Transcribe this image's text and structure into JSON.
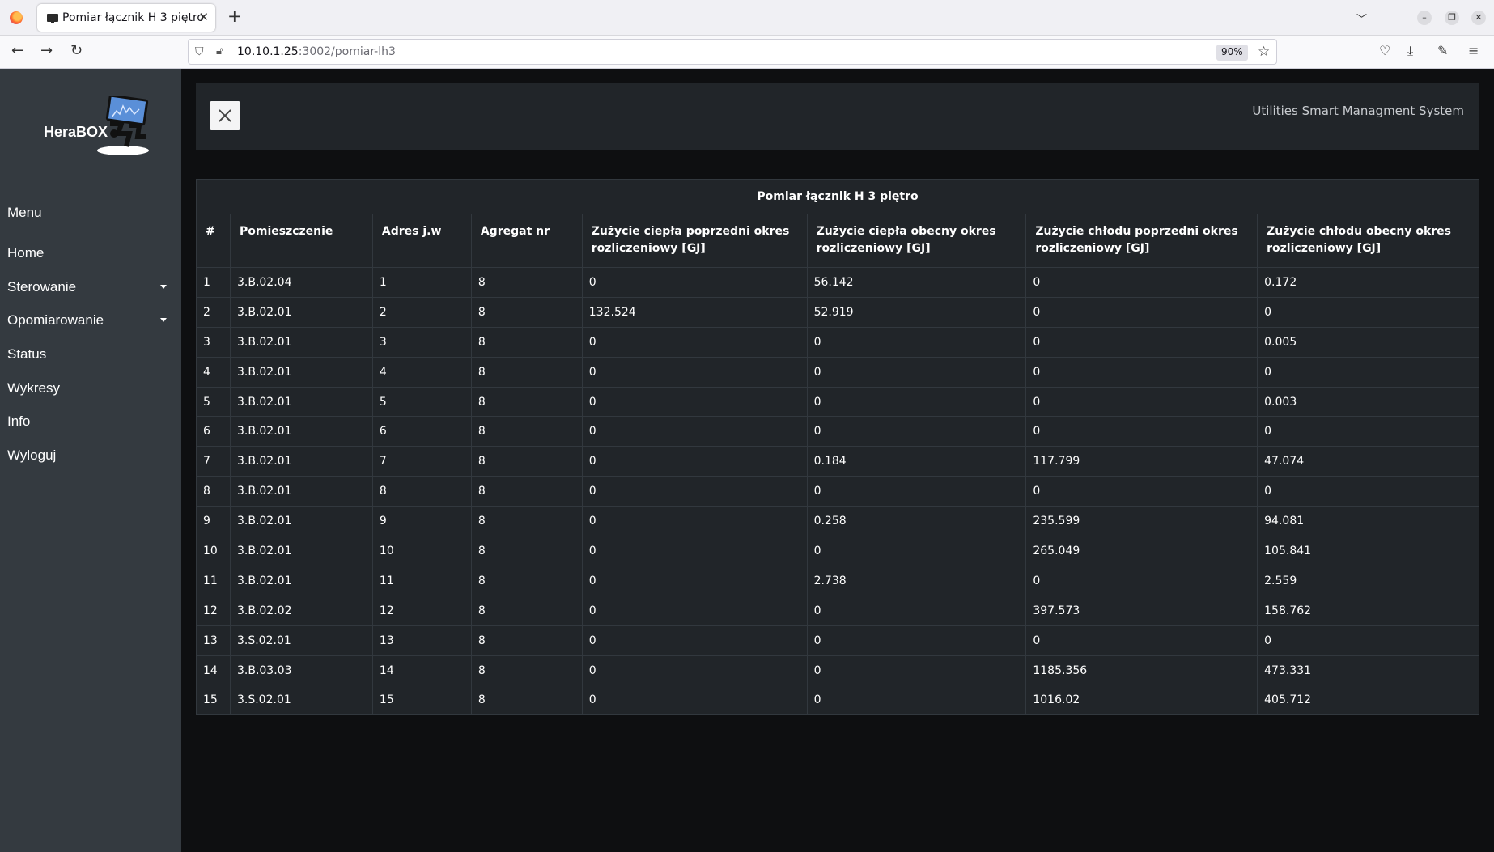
{
  "browser": {
    "tab_title": "Pomiar łącznik H 3 piętro",
    "url_host": "10.10.1.25",
    "url_path": ":3002/pomiar-lh3",
    "zoom": "90%"
  },
  "sidebar": {
    "logo_text": "HeraBOX",
    "menu_heading": "Menu",
    "items": [
      {
        "label": "Home"
      },
      {
        "label": "Sterowanie"
      },
      {
        "label": "Opomiarowanie"
      },
      {
        "label": "Status"
      },
      {
        "label": "Wykresy"
      },
      {
        "label": "Info"
      },
      {
        "label": "Wyloguj"
      }
    ]
  },
  "header": {
    "system_name": "Utilities Smart Managment System"
  },
  "table": {
    "caption": "Pomiar łącznik H 3 piętro",
    "columns": [
      "#",
      "Pomieszczenie",
      "Adres j.w",
      "Agregat nr",
      "Zużycie ciepła poprzedni okres rozliczeniowy [GJ]",
      "Zużycie ciepła obecny okres rozliczeniowy [GJ]",
      "Zużycie chłodu poprzedni okres rozliczeniowy [GJ]",
      "Zużycie chłodu obecny okres rozliczeniowy [GJ]"
    ],
    "rows": [
      [
        "1",
        "3.B.02.04",
        "1",
        "8",
        "0",
        "56.142",
        "0",
        "0.172"
      ],
      [
        "2",
        "3.B.02.01",
        "2",
        "8",
        "132.524",
        "52.919",
        "0",
        "0"
      ],
      [
        "3",
        "3.B.02.01",
        "3",
        "8",
        "0",
        "0",
        "0",
        "0.005"
      ],
      [
        "4",
        "3.B.02.01",
        "4",
        "8",
        "0",
        "0",
        "0",
        "0"
      ],
      [
        "5",
        "3.B.02.01",
        "5",
        "8",
        "0",
        "0",
        "0",
        "0.003"
      ],
      [
        "6",
        "3.B.02.01",
        "6",
        "8",
        "0",
        "0",
        "0",
        "0"
      ],
      [
        "7",
        "3.B.02.01",
        "7",
        "8",
        "0",
        "0.184",
        "117.799",
        "47.074"
      ],
      [
        "8",
        "3.B.02.01",
        "8",
        "8",
        "0",
        "0",
        "0",
        "0"
      ],
      [
        "9",
        "3.B.02.01",
        "9",
        "8",
        "0",
        "0.258",
        "235.599",
        "94.081"
      ],
      [
        "10",
        "3.B.02.01",
        "10",
        "8",
        "0",
        "0",
        "265.049",
        "105.841"
      ],
      [
        "11",
        "3.B.02.01",
        "11",
        "8",
        "0",
        "2.738",
        "0",
        "2.559"
      ],
      [
        "12",
        "3.B.02.02",
        "12",
        "8",
        "0",
        "0",
        "397.573",
        "158.762"
      ],
      [
        "13",
        "3.S.02.01",
        "13",
        "8",
        "0",
        "0",
        "0",
        "0"
      ],
      [
        "14",
        "3.B.03.03",
        "14",
        "8",
        "0",
        "0",
        "1185.356",
        "473.331"
      ],
      [
        "15",
        "3.S.02.01",
        "15",
        "8",
        "0",
        "0",
        "1016.02",
        "405.712"
      ]
    ]
  }
}
